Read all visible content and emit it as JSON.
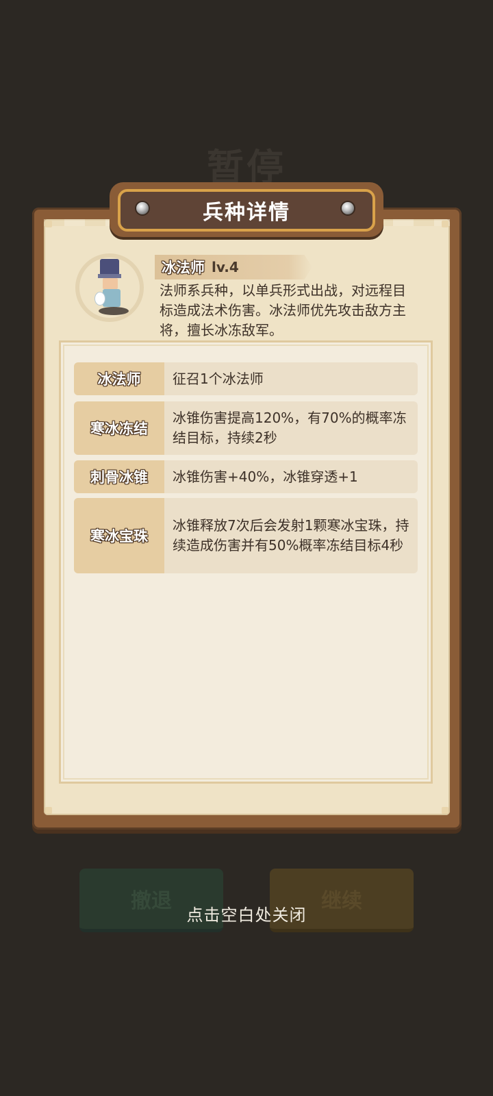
{
  "background": {
    "pause_title": "暂停",
    "retreat_button": "撤退",
    "continue_button": "继续"
  },
  "dialog": {
    "title": "兵种详情",
    "unit": {
      "name": "冰法师",
      "level": "lv.4",
      "description": "法师系兵种，以单兵形式出战，对远程目标造成法术伤害。冰法师优先攻击敌方主将，擅长冰冻敌军。",
      "avatar_icon": "ice-mage-portrait"
    },
    "skills": [
      {
        "name": "冰法师",
        "text": "征召1个冰法师"
      },
      {
        "name": "寒冰冻结",
        "text": "冰锥伤害提高120%，有70%的概率冻结目标，持续2秒"
      },
      {
        "name": "刺骨冰锥",
        "text": "冰锥伤害+40%，冰锥穿透+1"
      },
      {
        "name": "寒冰宝珠",
        "text": "冰锥释放7次后会发射1颗寒冰宝珠，持续造成伤害并有50%概率冻结目标4秒"
      }
    ]
  },
  "close_hint": "点击空白处关闭"
}
